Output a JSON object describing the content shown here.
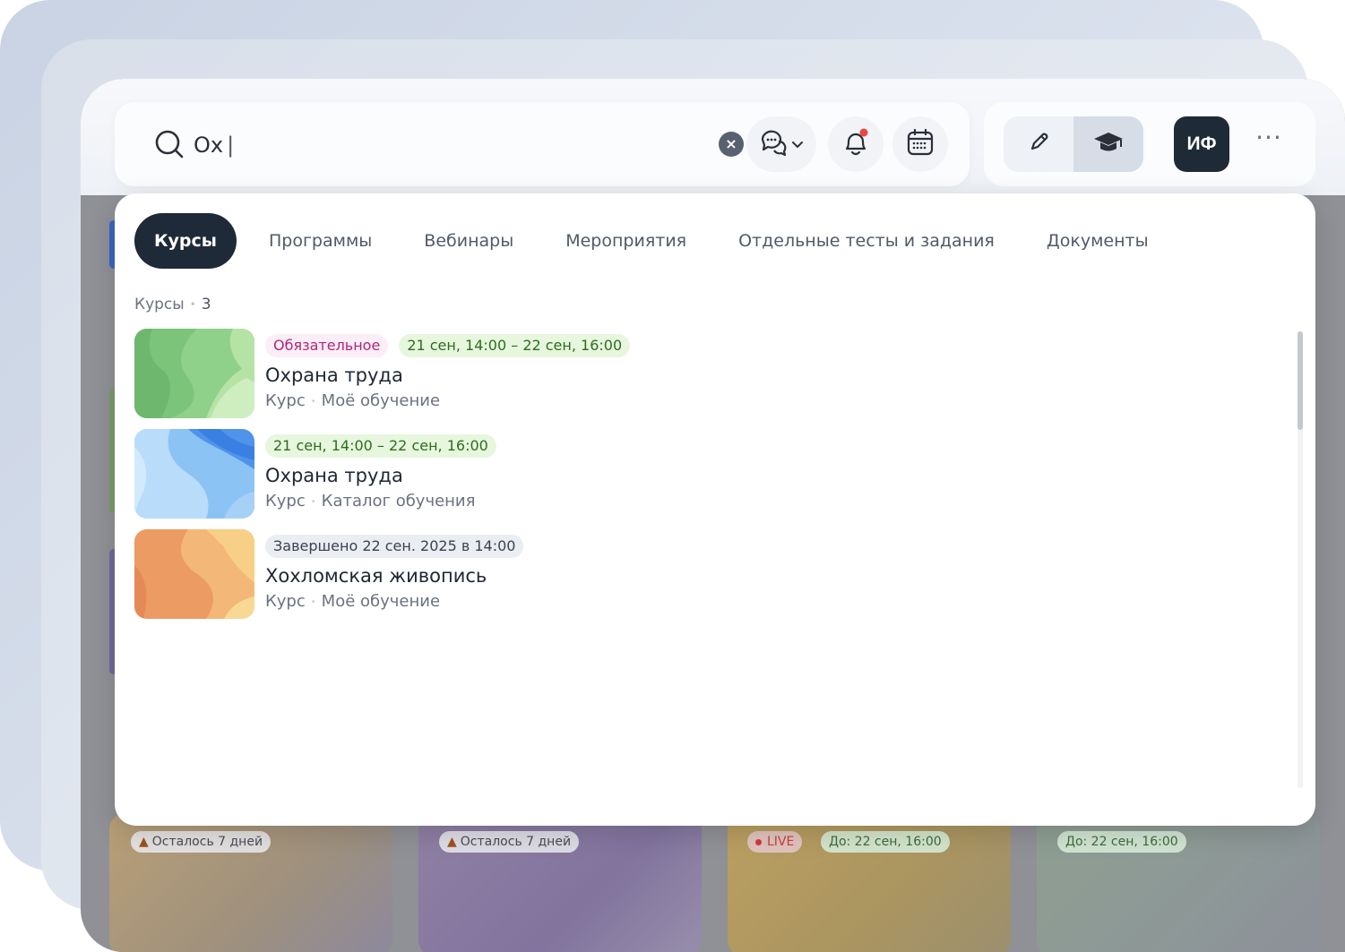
{
  "search": {
    "query": "Ох",
    "caret": "|"
  },
  "header": {
    "icons": [
      "search-icon",
      "chat-icon",
      "chevron-down-icon",
      "bell-icon",
      "calendar-icon",
      "pencil-icon",
      "graduation-cap-icon",
      "more-icon"
    ],
    "avatar_initials": "ИФ",
    "clear_glyph": "×",
    "more_glyph": "···",
    "notification_color": "#ef4444"
  },
  "tabs": [
    {
      "label": "Курсы",
      "active": true
    },
    {
      "label": "Программы",
      "active": false
    },
    {
      "label": "Вебинары",
      "active": false
    },
    {
      "label": "Мероприятия",
      "active": false
    },
    {
      "label": "Отдельные тесты и задания",
      "active": false
    },
    {
      "label": "Документы",
      "active": false
    }
  ],
  "section": {
    "title": "Курсы",
    "separator": "•",
    "count": "3"
  },
  "results": [
    {
      "tags": [
        {
          "kind": "required",
          "text": "Обязательное"
        },
        {
          "kind": "date",
          "text": "21 сен, 14:00 – 22 сен, 16:00"
        }
      ],
      "title": "Охрана труда",
      "type": "Курс",
      "source": "Моё обучение",
      "thumb": "green"
    },
    {
      "tags": [
        {
          "kind": "date",
          "text": "21 сен, 14:00 – 22 сен, 16:00"
        }
      ],
      "title": "Охрана труда",
      "type": "Курс",
      "source": "Каталог обучения",
      "thumb": "blue"
    },
    {
      "tags": [
        {
          "kind": "done",
          "text": "Завершено 22 сен. 2025 в 14:00"
        }
      ],
      "title": "Хохломская живопись",
      "type": "Курс",
      "source": "Моё обучение",
      "thumb": "orange"
    }
  ],
  "background_cards": [
    {
      "pill": "Осталось 7 дней",
      "kind": "warn"
    },
    {
      "pill": "Осталось 7 дней",
      "kind": "warn"
    },
    {
      "pill": "LIVE",
      "kind": "live",
      "extra": "До: 22 сен, 16:00"
    },
    {
      "pill": "До: 22 сен, 16:00",
      "kind": "due"
    }
  ],
  "colors": {
    "accent_dark": "#1e2a38",
    "required_text": "#b0267c",
    "date_text": "#2f6b1f",
    "live": "#d23a3a"
  }
}
